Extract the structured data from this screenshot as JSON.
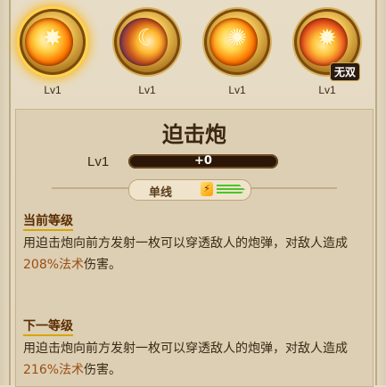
{
  "skills": [
    {
      "level": "Lv1",
      "active": true
    },
    {
      "level": "Lv1",
      "active": false
    },
    {
      "level": "Lv1",
      "active": false
    },
    {
      "level": "Lv1",
      "active": false,
      "badge": "无双"
    }
  ],
  "panel": {
    "title": "迫击炮",
    "level_label": "Lv1",
    "exp_text": "+0",
    "exp_fraction": 0.0,
    "tag_label": "单线",
    "current": {
      "heading": "当前等级",
      "desc_pre": "用迫击炮向前方发射一枚可以穿透敌人的炮弹，对敌人造成",
      "desc_value": "208%法术",
      "desc_post": "伤害。"
    },
    "next": {
      "heading": "下一等级",
      "desc_pre": "用迫击炮向前方发射一枚可以穿透敌人的炮弹，对敌人造成",
      "desc_value": "216%法术",
      "desc_post": "伤害。"
    }
  },
  "colors": {
    "background": "#e2d6bf",
    "highlight_text": "#9c4e12",
    "heading_text": "#5c2d00"
  }
}
